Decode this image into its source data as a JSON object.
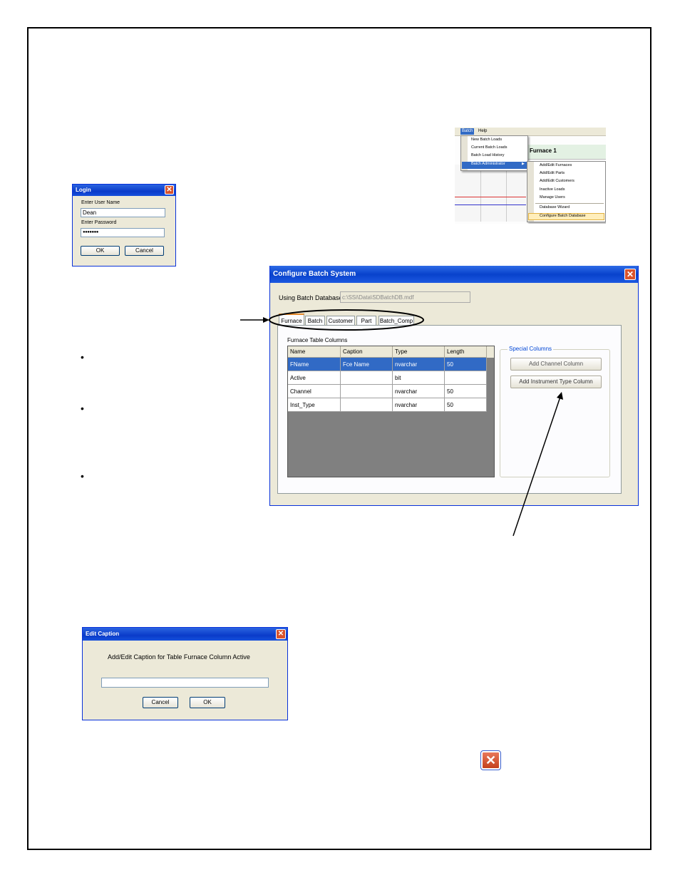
{
  "login": {
    "title": "Login",
    "user_label": "Enter User Name",
    "user_value": "Dean",
    "password_label": "Enter Password",
    "password_value": "●●●●●●●",
    "ok": "OK",
    "cancel": "Cancel"
  },
  "menu_shot": {
    "menubar": [
      "Batch",
      "Help"
    ],
    "batch_items": [
      "New Batch Loads",
      "Current Batch Loads",
      "Batch Load History",
      "Batch Administrator"
    ],
    "sub_items": [
      "Add/Edit Furnaces",
      "Add/Edit Parts",
      "Add/Edit Customers",
      "Inactive Loads",
      "Manage Users",
      "Database Wizard",
      "Configure Batch Database"
    ],
    "panel_title": "Furnace 1"
  },
  "configure": {
    "title": "Configure Batch System",
    "db_label": "Using Batch Database",
    "db_value": "c:\\SSi\\Data\\SDBatchDB.mdf",
    "tabs": [
      "Furnace",
      "Batch",
      "Customer",
      "Part",
      "Batch_Comp"
    ],
    "table_label": "Furnace Table Columns",
    "columns": [
      "Name",
      "Caption",
      "Type",
      "Length"
    ],
    "rows": [
      [
        "FName",
        "Fce Name",
        "nvarchar",
        "50"
      ],
      [
        "Active",
        "",
        "bit",
        ""
      ],
      [
        "Channel",
        "",
        "nvarchar",
        "50"
      ],
      [
        "Inst_Type",
        "",
        "nvarchar",
        "50"
      ]
    ],
    "special_label": "Special Columns",
    "add_channel": "Add Channel Column",
    "add_instrument": "Add Instrument Type Column"
  },
  "edit_caption": {
    "title": "Edit Caption",
    "prompt": "Add/Edit Caption for Table Furnace Column Active",
    "cancel": "Cancel",
    "ok": "OK"
  },
  "colors": {
    "xp_blue": "#0a3bc9",
    "close_red": "#d9532c",
    "selected_row": "#316ac5"
  }
}
